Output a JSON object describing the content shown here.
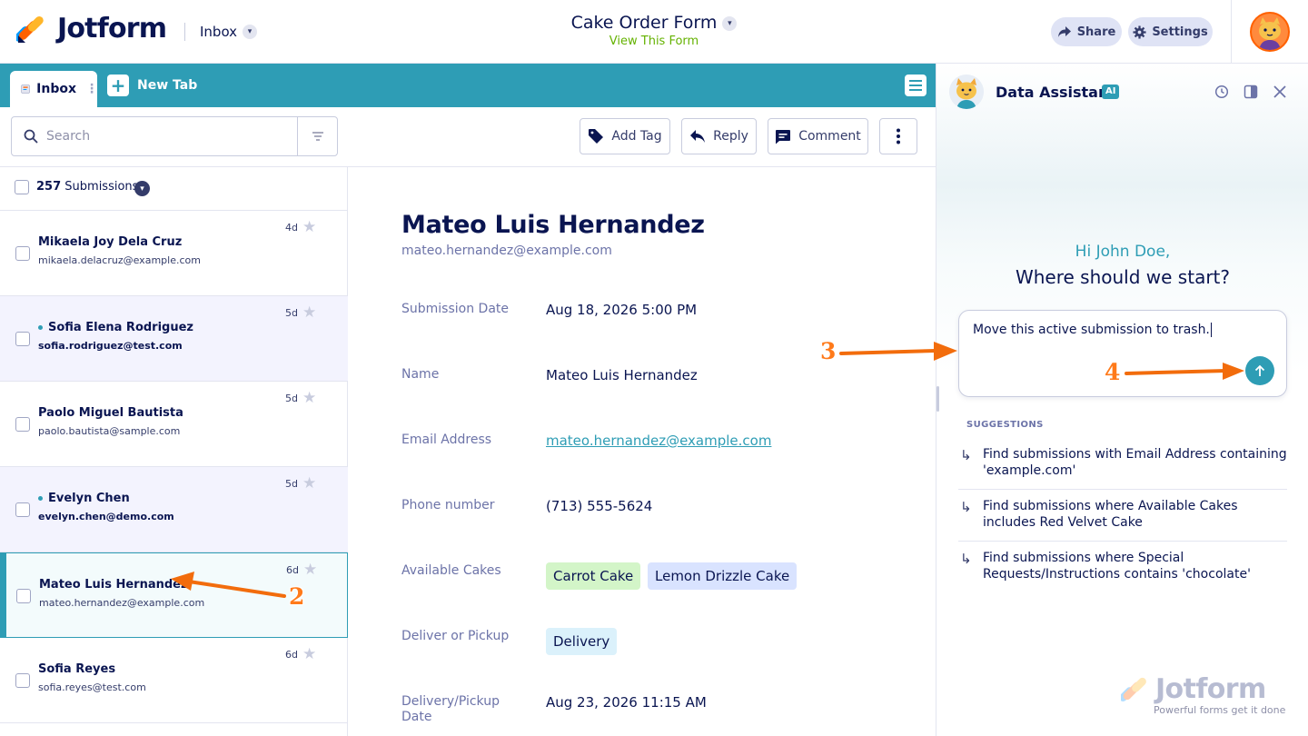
{
  "header": {
    "brand": "Jotform",
    "inbox_switch": "Inbox",
    "form_title": "Cake Order Form",
    "view_form": "View This Form",
    "share_label": "Share",
    "settings_label": "Settings"
  },
  "tabs": {
    "inbox_label": "Inbox",
    "new_tab_label": "New Tab"
  },
  "toolbar": {
    "search_placeholder": "Search",
    "add_tag_label": "Add Tag",
    "reply_label": "Reply",
    "comment_label": "Comment"
  },
  "list": {
    "count": "257",
    "count_suffix": "Submissions",
    "rows": [
      {
        "name": "Mikaela Joy Dela Cruz",
        "email": "mikaela.delacruz@example.com",
        "age": "4d",
        "unread": false
      },
      {
        "name": "Sofia Elena Rodriguez",
        "email": "sofia.rodriguez@test.com",
        "age": "5d",
        "unread": true
      },
      {
        "name": "Paolo Miguel Bautista",
        "email": "paolo.bautista@sample.com",
        "age": "5d",
        "unread": false
      },
      {
        "name": "Evelyn Chen",
        "email": "evelyn.chen@demo.com",
        "age": "5d",
        "unread": true
      },
      {
        "name": "Mateo Luis Hernandez",
        "email": "mateo.hernandez@example.com",
        "age": "6d",
        "unread": false,
        "active": true
      },
      {
        "name": "Sofia Reyes",
        "email": "sofia.reyes@test.com",
        "age": "6d",
        "unread": false
      }
    ]
  },
  "detail": {
    "name": "Mateo Luis Hernandez",
    "email": "mateo.hernandez@example.com",
    "fields": {
      "submission_date_label": "Submission Date",
      "submission_date_value": "Aug 18, 2026 5:00 PM",
      "name_label": "Name",
      "name_value": "Mateo Luis Hernandez",
      "email_label": "Email Address",
      "email_value": "mateo.hernandez@example.com",
      "phone_label": "Phone number",
      "phone_value": "(713) 555-5624",
      "cakes_label": "Available Cakes",
      "cake_tag_1": "Carrot Cake",
      "cake_tag_2": "Lemon Drizzle Cake",
      "deliver_label": "Deliver or Pickup",
      "deliver_value": "Delivery",
      "date_label_line1": "Delivery/Pickup",
      "date_label_line2": "Date",
      "date_value": "Aug 23, 2026 11:15 AM"
    }
  },
  "assistant": {
    "title": "Data Assistant",
    "ai_badge": "AI",
    "greeting": "Hi John Doe,",
    "question": "Where should we start?",
    "prompt_text": "Move this active submission to trash.",
    "suggestions_heading": "SUGGESTIONS",
    "suggestions": [
      "Find submissions with Email Address containing 'example.com'",
      "Find submissions where Available Cakes includes Red Velvet Cake",
      "Find submissions where Special Requests/Instructions contains 'chocolate'"
    ],
    "watermark": "Jotform",
    "watermark_tagline": "Powerful forms get it done"
  },
  "annotations": {
    "step_2": "2",
    "step_3": "3",
    "step_4": "4",
    "color": "#ff7a1a"
  },
  "colors": {
    "accent_teal": "#2e9db5",
    "navy": "#0a1551",
    "brand_orange": "#ff6100",
    "view_form_green": "#64b200"
  }
}
